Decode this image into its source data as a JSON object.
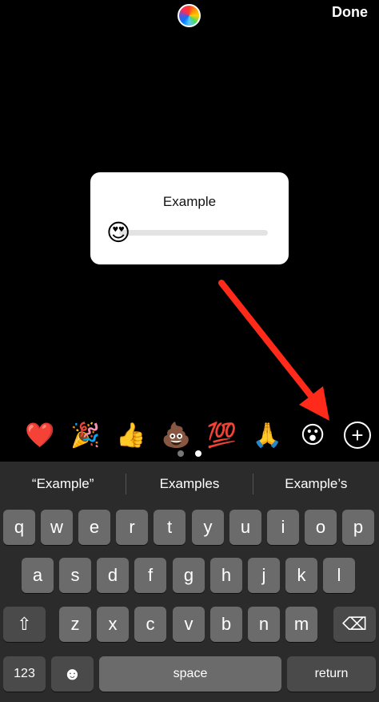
{
  "topbar": {
    "done_label": "Done",
    "color_wheel_icon": "color-wheel-icon"
  },
  "sticker": {
    "title": "Example",
    "emoji": "😍",
    "slider_value": 0
  },
  "emoji_bar": {
    "items": [
      "❤️",
      "🎉",
      "👍",
      "💩",
      "💯",
      "🙏",
      "😮"
    ],
    "add_icon": "+",
    "page_dots": 2,
    "active_page": 1
  },
  "keyboard": {
    "suggestions": [
      "“Example”",
      "Examples",
      "Example’s"
    ],
    "row1": [
      "q",
      "w",
      "e",
      "r",
      "t",
      "y",
      "u",
      "i",
      "o",
      "p"
    ],
    "row2": [
      "a",
      "s",
      "d",
      "f",
      "g",
      "h",
      "j",
      "k",
      "l"
    ],
    "row3": [
      "z",
      "x",
      "c",
      "v",
      "b",
      "n",
      "m"
    ],
    "numbers_label": "123",
    "emoji_key": "☻",
    "space_label": "space",
    "return_label": "return",
    "shift_icon": "⇧",
    "delete_icon": "⌫"
  },
  "colors": {
    "arrow": "#ff2a1a",
    "key": "#6b6b6b",
    "key_dark": "#4a4a4a",
    "keyboard_bg": "#2b2b2b"
  }
}
